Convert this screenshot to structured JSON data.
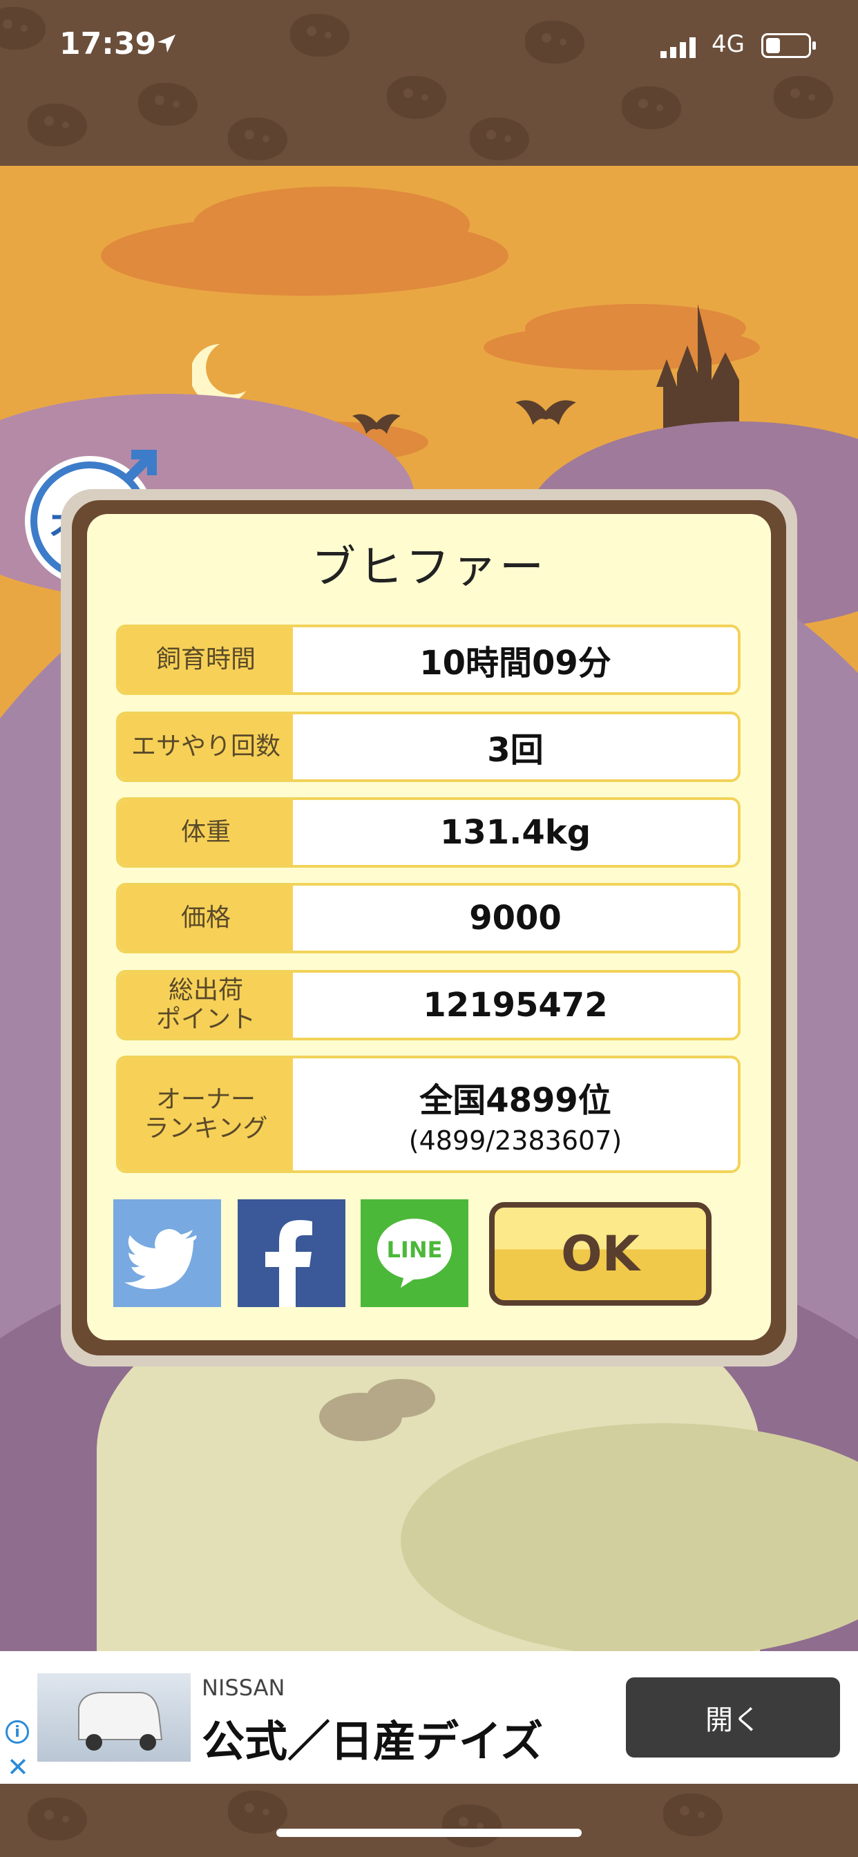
{
  "status_bar": {
    "time": "17:39",
    "network": "4G",
    "icons": [
      "location-arrow-icon",
      "signal-bars-icon",
      "battery-icon"
    ]
  },
  "badge": {
    "text": "オス",
    "icon": "male-symbol-icon"
  },
  "dialog": {
    "title": "ブヒファー",
    "rows": [
      {
        "label": "飼育時間",
        "value": "10時間09分"
      },
      {
        "label": "エサやり回数",
        "value": "3回"
      },
      {
        "label": "体重",
        "value": "131.4kg"
      },
      {
        "label": "価格",
        "value": "9000"
      },
      {
        "label": "総出荷\nポイント",
        "value": "12195472"
      },
      {
        "label": "オーナー\nランキング",
        "value": "全国4899位",
        "sub": "(4899/2383607)"
      }
    ],
    "share": [
      {
        "name": "twitter",
        "icon": "twitter-bird-icon"
      },
      {
        "name": "facebook",
        "icon": "facebook-f-icon"
      },
      {
        "name": "line",
        "icon": "line-icon",
        "text": "LINE"
      }
    ],
    "ok_label": "OK"
  },
  "ad": {
    "brand": "NISSAN",
    "title": "公式／日産デイズ",
    "button": "開く",
    "info_icon": "info-icon",
    "close_icon": "close-icon"
  },
  "colors": {
    "sky": "#e9a743",
    "panel": "#fffdd0",
    "label_bg": "#f7d157",
    "frame": "#6b4a32"
  }
}
